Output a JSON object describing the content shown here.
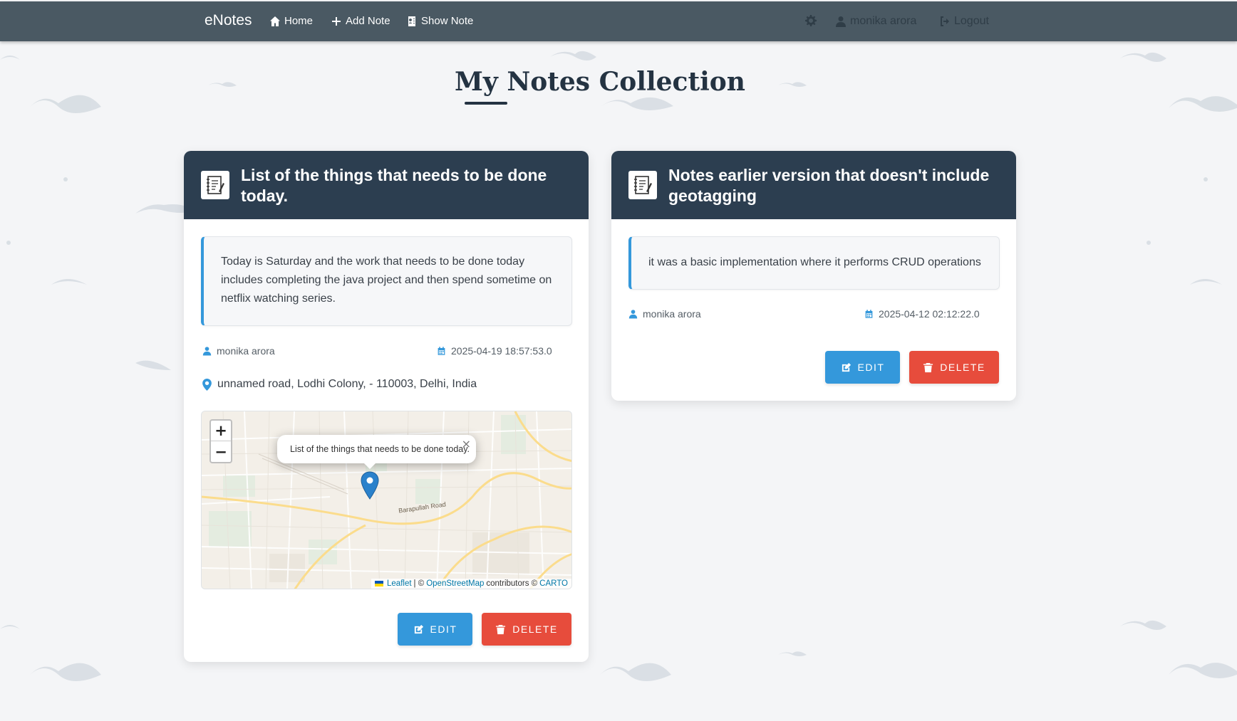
{
  "navbar": {
    "brand": "eNotes",
    "links": [
      {
        "label": "Home",
        "icon": "home-icon"
      },
      {
        "label": "Add Note",
        "icon": "plus-icon"
      },
      {
        "label": "Show Note",
        "icon": "address-book-icon"
      }
    ],
    "settings_icon": "gear-icon",
    "user": "monika arora",
    "logout": "Logout"
  },
  "page": {
    "title": "My Notes Collection"
  },
  "notes": [
    {
      "title": "List of the things that needs to be done today.",
      "content": "Today is Saturday and the work that needs to be done today includes completing the java project and then spend sometime on netflix watching series.",
      "author": "monika arora",
      "date": "2025-04-19 18:57:53.0",
      "location": "unnamed road, Lodhi Colony, - 110003, Delhi, India",
      "map": {
        "popup_text": "List of the things that needs to be done today.",
        "close": "×",
        "zoom_in": "+",
        "zoom_out": "−",
        "road_label": "Barapullah Road",
        "attribution": {
          "leaflet": "Leaflet",
          "sep": "| ©",
          "osm": "OpenStreetMap",
          "contributors": "contributors ©",
          "carto": "CARTO"
        }
      },
      "edit_label": "EDIT",
      "delete_label": "DELETE"
    },
    {
      "title": "Notes earlier version that doesn't include geotagging",
      "content": "it was a basic implementation where it performs CRUD operations",
      "author": "monika arora",
      "date": "2025-04-12 02:12:22.0",
      "edit_label": "EDIT",
      "delete_label": "DELETE"
    }
  ],
  "colors": {
    "navbar": "#4a5963",
    "card_header": "#2c3e50",
    "accent_blue": "#3498db",
    "danger_red": "#e74c3c",
    "background": "#f4f5f7"
  }
}
